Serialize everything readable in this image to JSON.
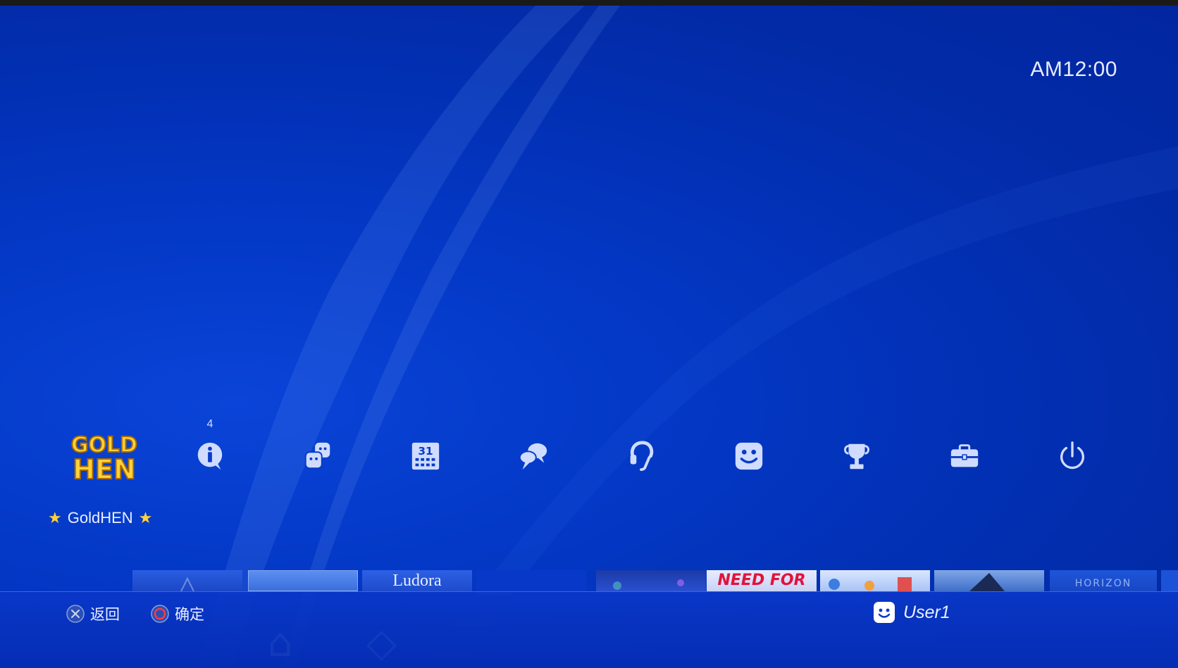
{
  "clock": {
    "time": "AM12:00"
  },
  "function_area": {
    "selected": {
      "label": "GoldHEN",
      "star_left": "★",
      "star_right": "★",
      "logo_line1": "GOLD",
      "logo_line2": "HEN"
    },
    "notification_badge": "4",
    "icons": [
      "information-icon",
      "friends-icon",
      "calendar-icon",
      "messages-icon",
      "party-icon",
      "profile-icon",
      "trophy-icon",
      "settings-toolbox-icon",
      "power-icon"
    ],
    "calendar_day": "31"
  },
  "content_tiles": {
    "visible_titles": [
      "Ludora",
      "NEED FOR",
      "HORIZON"
    ]
  },
  "bottom_bar": {
    "back_label": "返回",
    "confirm_label": "确定",
    "user_name": "User1"
  },
  "colors": {
    "background": "#0337c4",
    "logo_gold": "#ffd23a",
    "cross_button": "#8aa0d8",
    "circle_button": "#ff3b3b",
    "icon": "#cfdcff"
  }
}
